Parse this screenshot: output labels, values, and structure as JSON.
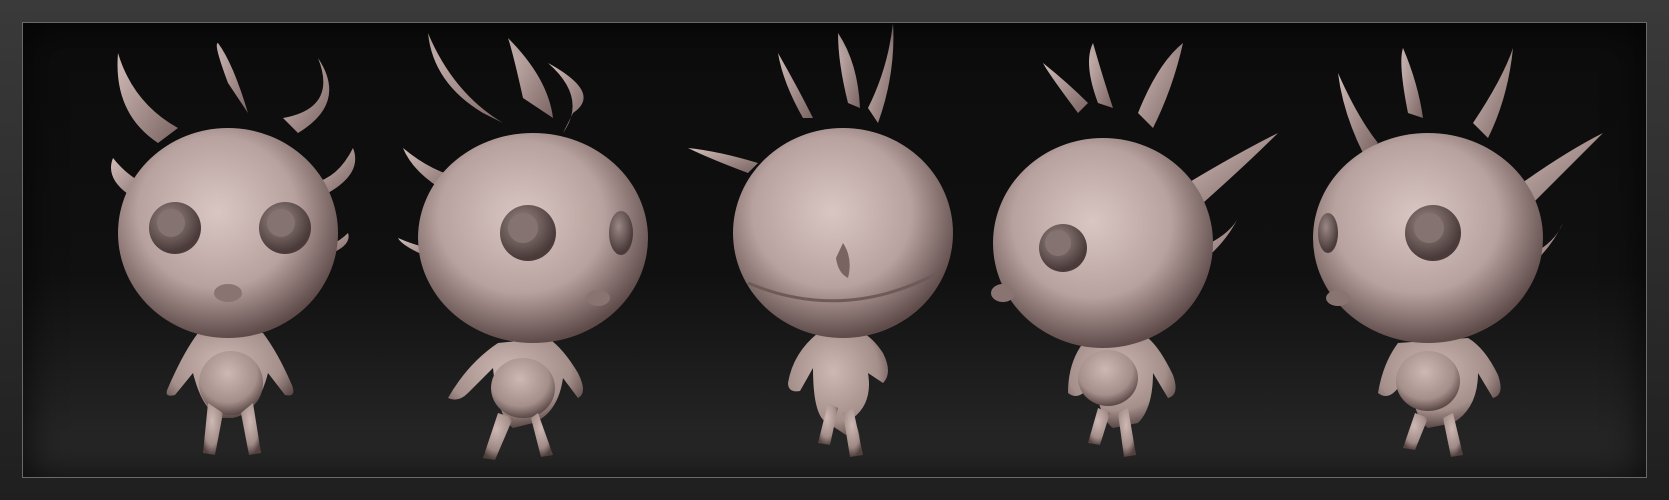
{
  "scene": {
    "subject": "creature-sculpt",
    "material_color": "#b8a29f",
    "shadow_color": "#6e5a58",
    "highlight_color": "#d9c6c2",
    "background_top": "#0c0c0c",
    "background_bottom": "#2a2a2a",
    "border_color": "#6a6a6a"
  },
  "views": [
    {
      "name": "front-view"
    },
    {
      "name": "three-quarter-left-view"
    },
    {
      "name": "back-view"
    },
    {
      "name": "profile-left-view"
    },
    {
      "name": "three-quarter-right-view"
    }
  ]
}
